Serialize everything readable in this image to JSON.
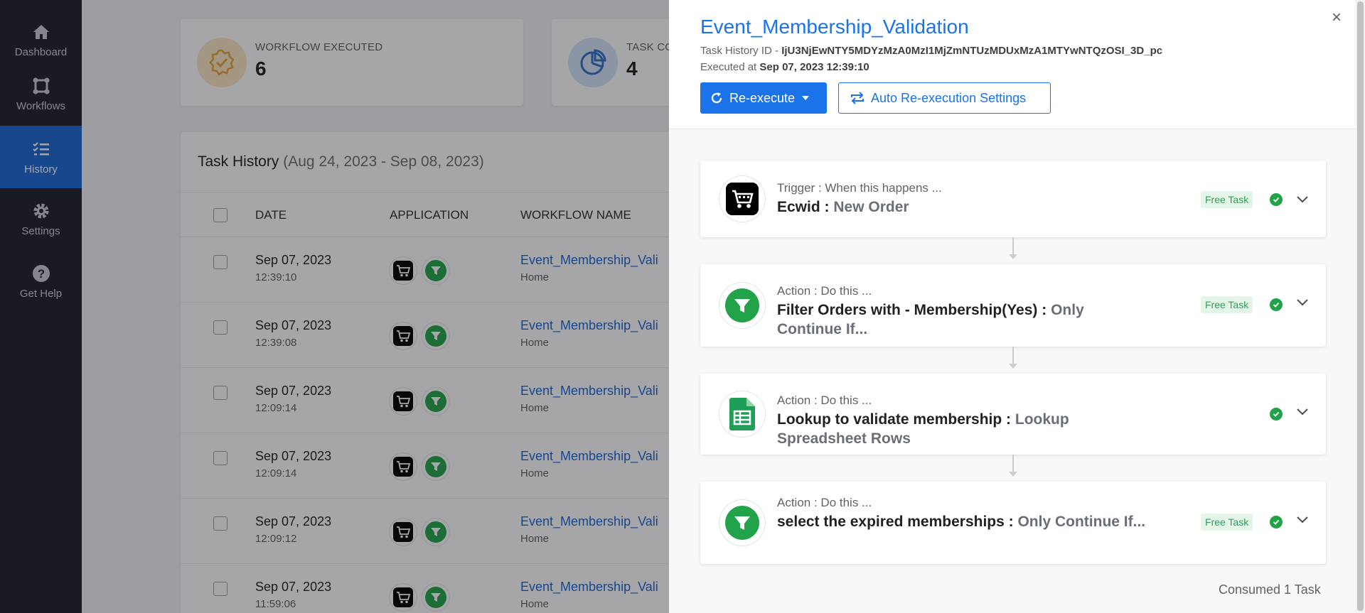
{
  "sidebar": {
    "items": [
      {
        "label": "Dashboard",
        "icon": "home-icon"
      },
      {
        "label": "Workflows",
        "icon": "workflow-icon"
      },
      {
        "label": "History",
        "icon": "history-list-icon",
        "active": true
      },
      {
        "label": "Settings",
        "icon": "gear-icon"
      },
      {
        "label": "Get Help",
        "icon": "help-icon"
      }
    ]
  },
  "stats": {
    "workflow_executed": {
      "label": "WORKFLOW EXECUTED",
      "value": "6"
    },
    "task_consumed": {
      "label": "TASK CO",
      "value": "4"
    }
  },
  "history": {
    "title": "Task History",
    "range": "(Aug 24, 2023 - Sep 08, 2023)",
    "columns": [
      "DATE",
      "APPLICATION",
      "WORKFLOW NAME"
    ],
    "rows": [
      {
        "date": "Sep 07, 2023",
        "time": "12:39:10",
        "workflow": "Event_Membership_Vali",
        "folder": "Home"
      },
      {
        "date": "Sep 07, 2023",
        "time": "12:39:08",
        "workflow": "Event_Membership_Vali",
        "folder": "Home"
      },
      {
        "date": "Sep 07, 2023",
        "time": "12:09:14",
        "workflow": "Event_Membership_Vali",
        "folder": "Home"
      },
      {
        "date": "Sep 07, 2023",
        "time": "12:09:14",
        "workflow": "Event_Membership_Vali",
        "folder": "Home"
      },
      {
        "date": "Sep 07, 2023",
        "time": "12:09:12",
        "workflow": "Event_Membership_Vali",
        "folder": "Home"
      },
      {
        "date": "Sep 07, 2023",
        "time": "11:59:06",
        "workflow": "Event_Membership_Vali",
        "folder": "Home"
      }
    ]
  },
  "drawer": {
    "title": "Event_Membership_Validation",
    "task_history_label": "Task History ID - ",
    "task_history_id": "IjU3NjEwNTY5MDYzMzA0MzI1MjZmNTUzMDUxMzA1MTYwNTQzOSI_3D_pc",
    "executed_label": "Executed at ",
    "executed_at": "Sep 07, 2023 12:39:10",
    "reexecute_label": "Re-execute",
    "auto_label": "Auto Re-execution Settings",
    "close": "×",
    "consumed": "Consumed 1 Task",
    "steps": [
      {
        "kind": "Trigger : When this happens ...",
        "title": "Ecwid : ",
        "sub": "New Order",
        "badge": "Free Task",
        "icon": "ecwid-cart-icon"
      },
      {
        "kind": "Action : Do this ...",
        "title": "Filter Orders with - Membership(Yes) : ",
        "sub": "Only Continue If...",
        "badge": "Free Task",
        "icon": "filter-icon"
      },
      {
        "kind": "Action : Do this ...",
        "title": "Lookup to validate membership : ",
        "sub": "Lookup Spreadsheet Rows",
        "badge": "",
        "icon": "google-sheets-icon"
      },
      {
        "kind": "Action : Do this ...",
        "title": "select the expired memberships : ",
        "sub": "Only Continue If...",
        "badge": "Free Task",
        "icon": "filter-icon"
      }
    ]
  },
  "colors": {
    "accent": "#1a73e8",
    "sidebar": "#1d2027",
    "success": "#22a34a",
    "badge_bg": "#e3f6e8"
  }
}
